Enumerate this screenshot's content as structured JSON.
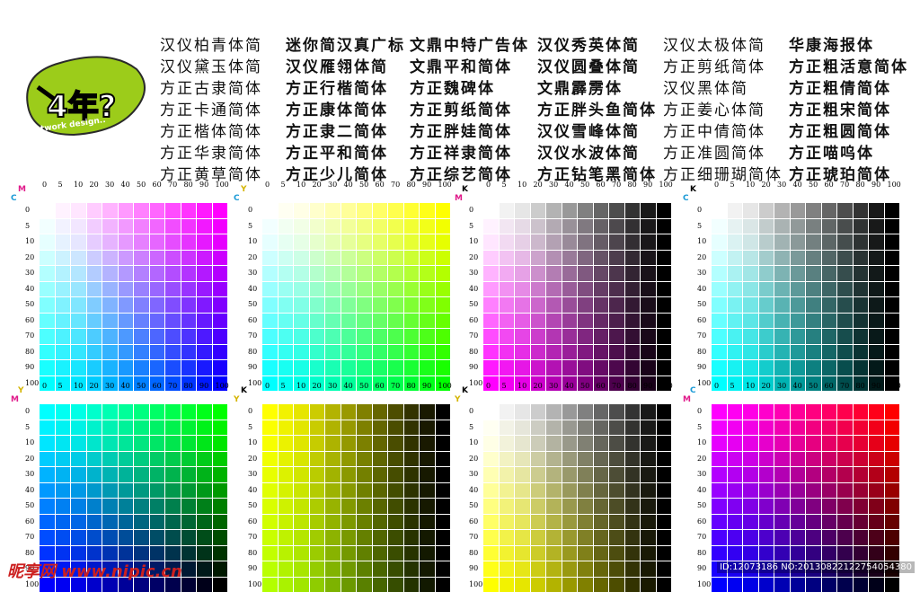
{
  "logo": {
    "main_text": "4年?",
    "subtitle": "Network design.."
  },
  "font_names": [
    [
      "汉仪柏青体简",
      "汉仪黛玉体简",
      "方正古隶简体",
      "方正卡通简体",
      "方正楷体简体",
      "方正华隶简体",
      "方正黄草简体"
    ],
    [
      "迷你简汉真广标",
      "汉仪雁翎体简",
      "方正行楷简体",
      "方正康体简体",
      "方正隶二简体",
      "方正平和简体",
      "方正少儿简体"
    ],
    [
      "文鼎中特广告体",
      "文鼎平和简体",
      "方正魏碑体",
      "方正剪纸简体",
      "方正胖娃简体",
      "方正祥隶简体",
      "方正综艺简体"
    ],
    [
      "汉仪秀英体简",
      "汉仪圆叠体简",
      "文鼎霹雳体",
      "方正胖头鱼简体",
      "汉仪雪峰体简",
      "汉仪水波体简",
      "方正钻笔黑简体"
    ],
    [
      "汉仪太极体简",
      "方正剪纸简体",
      "汉仪黑体简",
      "方正姜心体简",
      "方正中倩简体",
      "方正准圆简体",
      "方正细珊瑚简体"
    ],
    [
      "华康海报体",
      "方正粗活意简体",
      "方正粗倩简体",
      "方正粗宋简体",
      "方正粗圆简体",
      "方正喵呜体",
      "方正琥珀简体"
    ]
  ],
  "axis_ticks": [
    "0",
    "5",
    "10",
    "20",
    "30",
    "40",
    "50",
    "60",
    "70",
    "80",
    "90",
    "100"
  ],
  "panels": [
    {
      "x_tag": "M",
      "y_tag": "C",
      "x_tag_color": "#e0198a",
      "y_tag_color": "#1a9ad6",
      "mode": "MC"
    },
    {
      "x_tag": "Y",
      "y_tag": "C",
      "x_tag_color": "#d4b400",
      "y_tag_color": "#1a9ad6",
      "mode": "YC"
    },
    {
      "x_tag": "K",
      "y_tag": "M",
      "x_tag_color": "#000000",
      "y_tag_color": "#e0198a",
      "mode": "KM"
    },
    {
      "x_tag": "K",
      "y_tag": "C",
      "x_tag_color": "#000000",
      "y_tag_color": "#1a9ad6",
      "mode": "KC"
    },
    {
      "x_tag": "Y",
      "y_tag": "M",
      "x_tag_color": "#d4b400",
      "y_tag_color": "#e0198a",
      "mode": "YM_C100"
    },
    {
      "x_tag": "K",
      "y_tag": "Y",
      "x_tag_color": "#000000",
      "y_tag_color": "#d4b400",
      "mode": "KY_C50"
    },
    {
      "x_tag": "K",
      "y_tag": "Y",
      "x_tag_color": "#000000",
      "y_tag_color": "#d4b400",
      "mode": "KY"
    },
    {
      "x_tag": "C",
      "y_tag": "M",
      "x_tag_color": "#1a9ad6",
      "y_tag_color": "#e0198a",
      "mode": "CM_M100"
    }
  ],
  "watermark": {
    "left": "昵享网 www.nipic.cn",
    "right": "ID:12073186 NO:20130822122754054380"
  }
}
